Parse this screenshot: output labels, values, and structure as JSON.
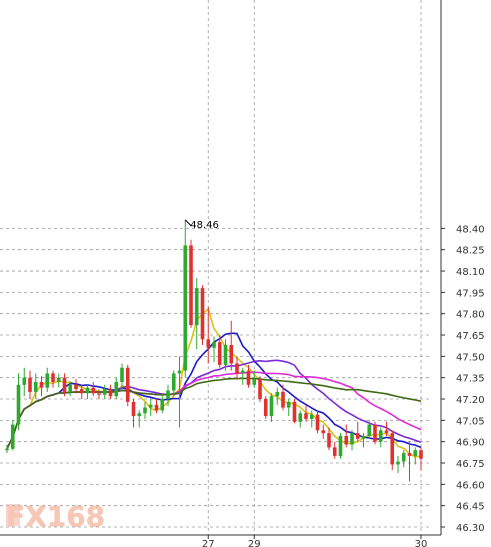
{
  "chart_data": {
    "type": "candlestick",
    "peak_label": "48.46",
    "x_ticks": [
      {
        "label": "27",
        "index": 35
      },
      {
        "label": "29",
        "index": 43
      },
      {
        "label": "30",
        "index": 72
      }
    ],
    "ylim": [
      46.3,
      48.55
    ],
    "y_ticks": [
      48.4,
      48.25,
      48.1,
      47.95,
      47.8,
      47.65,
      47.5,
      47.35,
      47.2,
      47.05,
      46.9,
      46.75,
      46.6,
      46.45,
      46.3
    ],
    "grid": true,
    "colors": {
      "up": "#2ea82e",
      "down": "#e03131",
      "ma_yellow": "#d8c31a",
      "ma_blue": "#1a1acb",
      "ma_purple": "#7a2ad8",
      "ma_magenta": "#e02ad8",
      "ma_olive": "#3e6b12"
    },
    "candles": [
      [
        46.84,
        46.88,
        46.82,
        46.85
      ],
      [
        46.85,
        47.05,
        46.84,
        47.02
      ],
      [
        47.02,
        47.38,
        46.98,
        47.3
      ],
      [
        47.3,
        47.42,
        47.22,
        47.35
      ],
      [
        47.35,
        47.4,
        47.2,
        47.25
      ],
      [
        47.25,
        47.38,
        47.2,
        47.32
      ],
      [
        47.32,
        47.36,
        47.22,
        47.28
      ],
      [
        47.28,
        47.42,
        47.25,
        47.38
      ],
      [
        47.38,
        47.4,
        47.28,
        47.32
      ],
      [
        47.32,
        47.38,
        47.28,
        47.35
      ],
      [
        47.35,
        47.38,
        47.22,
        47.25
      ],
      [
        47.25,
        47.32,
        47.22,
        47.3
      ],
      [
        47.3,
        47.34,
        47.24,
        47.27
      ],
      [
        47.27,
        47.3,
        47.2,
        47.24
      ],
      [
        47.24,
        47.3,
        47.2,
        47.28
      ],
      [
        47.28,
        47.32,
        47.22,
        47.24
      ],
      [
        47.24,
        47.27,
        47.2,
        47.23
      ],
      [
        47.23,
        47.3,
        47.2,
        47.27
      ],
      [
        47.27,
        47.3,
        47.2,
        47.22
      ],
      [
        47.22,
        47.35,
        47.2,
        47.32
      ],
      [
        47.32,
        47.45,
        47.26,
        47.42
      ],
      [
        47.42,
        47.44,
        47.15,
        47.18
      ],
      [
        47.18,
        47.2,
        47.0,
        47.08
      ],
      [
        47.08,
        47.12,
        47.0,
        47.1
      ],
      [
        47.1,
        47.18,
        47.06,
        47.14
      ],
      [
        47.14,
        47.2,
        47.08,
        47.16
      ],
      [
        47.16,
        47.2,
        47.1,
        47.12
      ],
      [
        47.12,
        47.22,
        47.1,
        47.2
      ],
      [
        47.2,
        47.3,
        47.15,
        47.26
      ],
      [
        47.26,
        47.4,
        47.22,
        47.38
      ],
      [
        47.38,
        47.5,
        47.0,
        47.4
      ],
      [
        47.4,
        48.46,
        47.35,
        48.28
      ],
      [
        48.28,
        48.32,
        47.7,
        47.72
      ],
      [
        47.72,
        48.05,
        47.55,
        47.98
      ],
      [
        47.98,
        48.0,
        47.58,
        47.62
      ],
      [
        47.62,
        47.85,
        47.45,
        47.56
      ],
      [
        47.56,
        47.64,
        47.46,
        47.6
      ],
      [
        47.6,
        47.65,
        47.42,
        47.44
      ],
      [
        47.44,
        47.62,
        47.4,
        47.58
      ],
      [
        47.58,
        47.75,
        47.4,
        47.45
      ],
      [
        47.45,
        47.5,
        47.34,
        47.38
      ],
      [
        47.38,
        47.42,
        47.3,
        47.4
      ],
      [
        47.4,
        47.44,
        47.28,
        47.3
      ],
      [
        47.3,
        47.4,
        47.28,
        47.34
      ],
      [
        47.34,
        47.36,
        47.18,
        47.2
      ],
      [
        47.2,
        47.22,
        47.06,
        47.08
      ],
      [
        47.08,
        47.24,
        47.04,
        47.22
      ],
      [
        47.22,
        47.28,
        47.16,
        47.25
      ],
      [
        47.25,
        47.3,
        47.12,
        47.14
      ],
      [
        47.14,
        47.2,
        47.08,
        47.18
      ],
      [
        47.18,
        47.2,
        47.03,
        47.04
      ],
      [
        47.04,
        47.12,
        47.0,
        47.1
      ],
      [
        47.1,
        47.16,
        47.04,
        47.06
      ],
      [
        47.06,
        47.12,
        47.0,
        47.09
      ],
      [
        47.09,
        47.12,
        46.96,
        46.98
      ],
      [
        46.98,
        47.02,
        46.92,
        46.96
      ],
      [
        46.96,
        47.0,
        46.84,
        46.86
      ],
      [
        46.86,
        46.9,
        46.78,
        46.8
      ],
      [
        46.8,
        46.96,
        46.78,
        46.94
      ],
      [
        46.94,
        47.02,
        46.86,
        46.88
      ],
      [
        46.88,
        46.98,
        46.84,
        46.96
      ],
      [
        46.96,
        47.04,
        46.9,
        46.92
      ],
      [
        46.92,
        46.96,
        46.86,
        46.94
      ],
      [
        46.94,
        47.05,
        46.92,
        47.02
      ],
      [
        47.02,
        47.04,
        46.88,
        46.9
      ],
      [
        46.9,
        47.0,
        46.86,
        46.98
      ],
      [
        46.98,
        47.04,
        46.94,
        46.96
      ],
      [
        46.96,
        46.98,
        46.7,
        46.74
      ],
      [
        46.74,
        46.8,
        46.68,
        46.76
      ],
      [
        46.76,
        46.84,
        46.72,
        46.82
      ],
      [
        46.82,
        46.9,
        46.62,
        46.8
      ],
      [
        46.8,
        46.86,
        46.74,
        46.84
      ],
      [
        46.84,
        46.86,
        46.7,
        46.78
      ]
    ]
  },
  "watermark": {
    "text": "FX168"
  }
}
